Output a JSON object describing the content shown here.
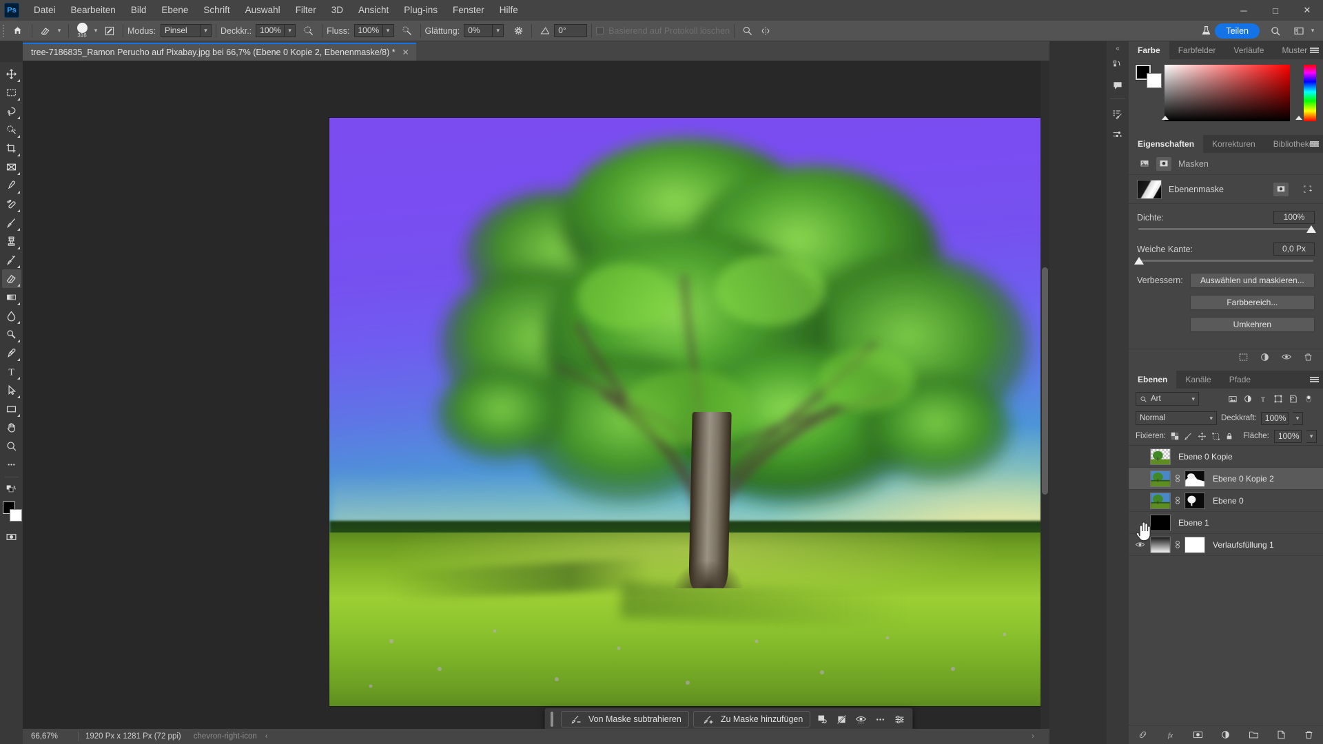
{
  "app": {
    "name": "Photoshop",
    "logo_text": "Ps"
  },
  "menubar": {
    "items": [
      "Datei",
      "Bearbeiten",
      "Bild",
      "Ebene",
      "Schrift",
      "Auswahl",
      "Filter",
      "3D",
      "Ansicht",
      "Plug-ins",
      "Fenster",
      "Hilfe"
    ],
    "window_controls": {
      "minimize": "─",
      "maximize": "□",
      "close": "✕"
    }
  },
  "optionsbar": {
    "home_icon": "home-icon",
    "tool_icon": "eraser-tool-icon",
    "brush_size": "316",
    "brush_settings_icon": "brush-settings-icon",
    "mode_label": "Modus:",
    "mode_value": "Pinsel",
    "opacity_label": "Deckkr.:",
    "opacity_value": "100%",
    "pressure_opacity_icon": "pressure-opacity-icon",
    "flow_label": "Fluss:",
    "flow_value": "100%",
    "airbrush_icon": "airbrush-icon",
    "smoothing_label": "Glättung:",
    "smoothing_value": "0%",
    "smoothing_options_icon": "gear-icon",
    "angle_icon": "angle-icon",
    "angle_value": "0°",
    "history_erase_label": "Basierend auf Protokoll löschen",
    "pressure_size_icon": "pressure-size-icon",
    "symmetry_icon": "symmetry-icon",
    "lab_icon": "lab-flask-icon",
    "share_label": "Teilen",
    "search_icon": "search-icon",
    "workspace_icon": "workspace-icon",
    "workspace_caret": "chevron-down-icon"
  },
  "toolbar": {
    "tools": [
      {
        "name": "move-tool",
        "icon": "move-icon"
      },
      {
        "name": "marquee-tool",
        "icon": "rect-marquee-icon"
      },
      {
        "name": "lasso-tool",
        "icon": "lasso-icon"
      },
      {
        "name": "object-selection-tool",
        "icon": "object-selection-icon"
      },
      {
        "name": "crop-tool",
        "icon": "crop-icon"
      },
      {
        "name": "frame-tool",
        "icon": "frame-icon"
      },
      {
        "name": "eyedropper-tool",
        "icon": "eyedropper-icon"
      },
      {
        "name": "healing-brush-tool",
        "icon": "healing-brush-icon"
      },
      {
        "name": "brush-tool",
        "icon": "brush-icon"
      },
      {
        "name": "clone-stamp-tool",
        "icon": "clone-stamp-icon"
      },
      {
        "name": "history-brush-tool",
        "icon": "history-brush-icon"
      },
      {
        "name": "eraser-tool",
        "icon": "eraser-icon",
        "active": true
      },
      {
        "name": "gradient-tool",
        "icon": "gradient-icon"
      },
      {
        "name": "blur-tool",
        "icon": "blur-drop-icon"
      },
      {
        "name": "dodge-tool",
        "icon": "dodge-icon"
      },
      {
        "name": "pen-tool",
        "icon": "pen-icon"
      },
      {
        "name": "type-tool",
        "icon": "type-T-icon"
      },
      {
        "name": "path-selection-tool",
        "icon": "path-arrow-icon"
      },
      {
        "name": "shape-tool",
        "icon": "rectangle-icon"
      },
      {
        "name": "hand-tool",
        "icon": "hand-icon"
      },
      {
        "name": "zoom-tool",
        "icon": "magnifier-icon"
      },
      {
        "name": "edit-toolbar",
        "icon": "ellipsis-icon"
      }
    ],
    "foreground_color": "#000000",
    "background_color": "#ffffff",
    "quick-mask-icon": "quick-mask-icon",
    "screen-mode-icon": "screen-mode-icon"
  },
  "document": {
    "tab_title": "tree-7186835_Ramon Perucho auf Pixabay.jpg bei 66,7% (Ebene 0 Kopie 2, Ebenenmaske/8) *",
    "close_icon": "close-icon"
  },
  "statusbar": {
    "zoom": "66,67%",
    "doc_size": "1920 Px x 1281 Px (72 ppi)",
    "expand_icon": "chevron-right-icon",
    "collapse_icon": "chevron-left-icon"
  },
  "mask_toolbar": {
    "subtract_label": "Von Maske subtrahieren",
    "subtract_icon": "brush-minus-icon",
    "add_label": "Zu Maske hinzufügen",
    "add_icon": "brush-plus-icon",
    "selection_icon": "selection-settings-icon",
    "disable_icon": "disable-mask-icon",
    "view_icon": "eye-options-icon",
    "more_icon": "ellipsis-icon",
    "settings_icon": "sliders-icon"
  },
  "right_rail": {
    "collapse_icon": "double-chevron-left-icon",
    "icons": [
      "history-icon",
      "comments-icon",
      "actions-icon",
      "brush-presets-icon"
    ]
  },
  "color_panel": {
    "tabs": [
      "Farbe",
      "Farbfelder",
      "Verläufe",
      "Muster"
    ],
    "active_tab": "Farbe",
    "menu_icon": "panel-menu-icon",
    "foreground": "#000000",
    "background": "#ffffff"
  },
  "properties_panel": {
    "tabs": [
      "Eigenschaften",
      "Korrekturen",
      "Bibliotheken"
    ],
    "active_tab": "Eigenschaften",
    "menu_icon": "panel-menu-icon",
    "section_label": "Masken",
    "pixel_mask_icon": "pixel-mask-icon",
    "vector_mask_icon": "vector-mask-icon",
    "mask_name": "Ebenenmaske",
    "mask_select_icon": "select-mask-icon",
    "mask_vector_icon": "add-vector-mask-icon",
    "density_label": "Dichte:",
    "density_value": "100%",
    "feather_label": "Weiche Kante:",
    "feather_value": "0,0 Px",
    "refine_label": "Verbessern:",
    "buttons": [
      "Auswählen und maskieren...",
      "Farbbereich...",
      "Umkehren"
    ],
    "footer_icons": [
      "load-selection-icon",
      "apply-mask-icon",
      "toggle-visibility-icon",
      "delete-mask-icon"
    ]
  },
  "layers_panel": {
    "tabs": [
      "Ebenen",
      "Kanäle",
      "Pfade"
    ],
    "active_tab": "Ebenen",
    "menu_icon": "panel-menu-icon",
    "filter_label": "Art",
    "filter_search_icon": "search-icon",
    "filter_icons": [
      "pixel-filter-icon",
      "adjustment-filter-icon",
      "type-filter-icon",
      "shape-filter-icon",
      "smart-object-filter-icon"
    ],
    "filter_toggle_icon": "filter-toggle-icon",
    "blend_mode": "Normal",
    "opacity_label": "Deckkraft:",
    "opacity_value": "100%",
    "lock_label": "Fixieren:",
    "lock_icons": [
      "lock-transparency-icon",
      "lock-image-icon",
      "lock-position-icon",
      "lock-artboard-icon",
      "lock-all-icon"
    ],
    "fill_label": "Fläche:",
    "fill_value": "100%",
    "layers": [
      {
        "name": "Ebene 0 Kopie",
        "visible": false,
        "has_mask": false,
        "selected": false,
        "thumb": "tree-transparent"
      },
      {
        "name": "Ebene 0 Kopie 2",
        "visible": false,
        "has_mask": true,
        "selected": true,
        "thumb": "tree-photo",
        "mask": "tree-mask-white"
      },
      {
        "name": "Ebene 0",
        "visible": false,
        "has_mask": true,
        "selected": false,
        "thumb": "tree-photo",
        "mask": "tree-mask-small"
      },
      {
        "name": "Ebene 1",
        "visible": false,
        "has_mask": false,
        "selected": false,
        "thumb": "solid-black"
      },
      {
        "name": "Verlaufsfüllung 1",
        "visible": true,
        "has_mask": true,
        "selected": false,
        "thumb": "gradient",
        "mask": "white"
      }
    ],
    "footer_icons": [
      "link-layers-icon",
      "layer-style-fx-icon",
      "add-mask-icon",
      "new-adjustment-icon",
      "new-group-icon",
      "new-layer-icon",
      "delete-layer-icon"
    ]
  },
  "canvas": {
    "image_alt": "tree-in-field-purple-sky",
    "scrollbar_v": "vertical-scrollbar",
    "scrollbar_h": "horizontal-scrollbar"
  },
  "colors": {
    "accent": "#1473e6",
    "panel_bg": "#454545",
    "chrome_bg": "#393939",
    "canvas_bg": "#282828",
    "menu_bg": "#444444",
    "options_bg": "#535353",
    "layer_name": "#e2e2e2"
  }
}
